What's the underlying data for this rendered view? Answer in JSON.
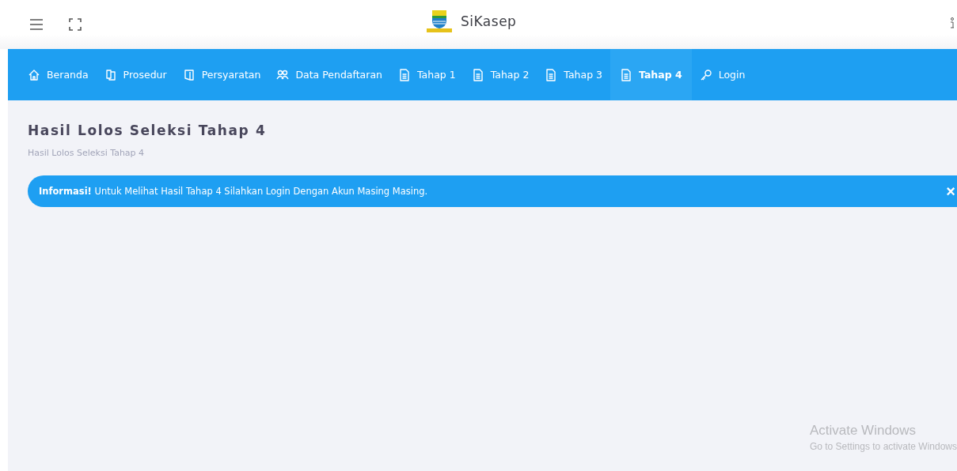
{
  "header": {
    "brand": "SiKasep"
  },
  "nav": [
    {
      "label": "Beranda",
      "selected": false
    },
    {
      "label": "Prosedur",
      "selected": false
    },
    {
      "label": "Persyaratan",
      "selected": false
    },
    {
      "label": "Data Pendaftaran",
      "selected": false
    },
    {
      "label": "Tahap 1",
      "selected": false
    },
    {
      "label": "Tahap 2",
      "selected": false
    },
    {
      "label": "Tahap 3",
      "selected": false
    },
    {
      "label": "Tahap 4",
      "selected": true
    },
    {
      "label": "Login",
      "selected": false
    }
  ],
  "page": {
    "title": "Hasil Lolos Seleksi Tahap 4",
    "breadcrumb": "Hasil Lolos Seleksi Tahap 4"
  },
  "alert": {
    "text": "**Informasi!** Untuk Melihat Hasil Tahap 4 Silahkan Login Dengan Akun Masing Masing.",
    "close": "×"
  },
  "os_notice": {
    "title": "Activate Windows",
    "subtitle": "Go to Settings to activate Windows"
  }
}
